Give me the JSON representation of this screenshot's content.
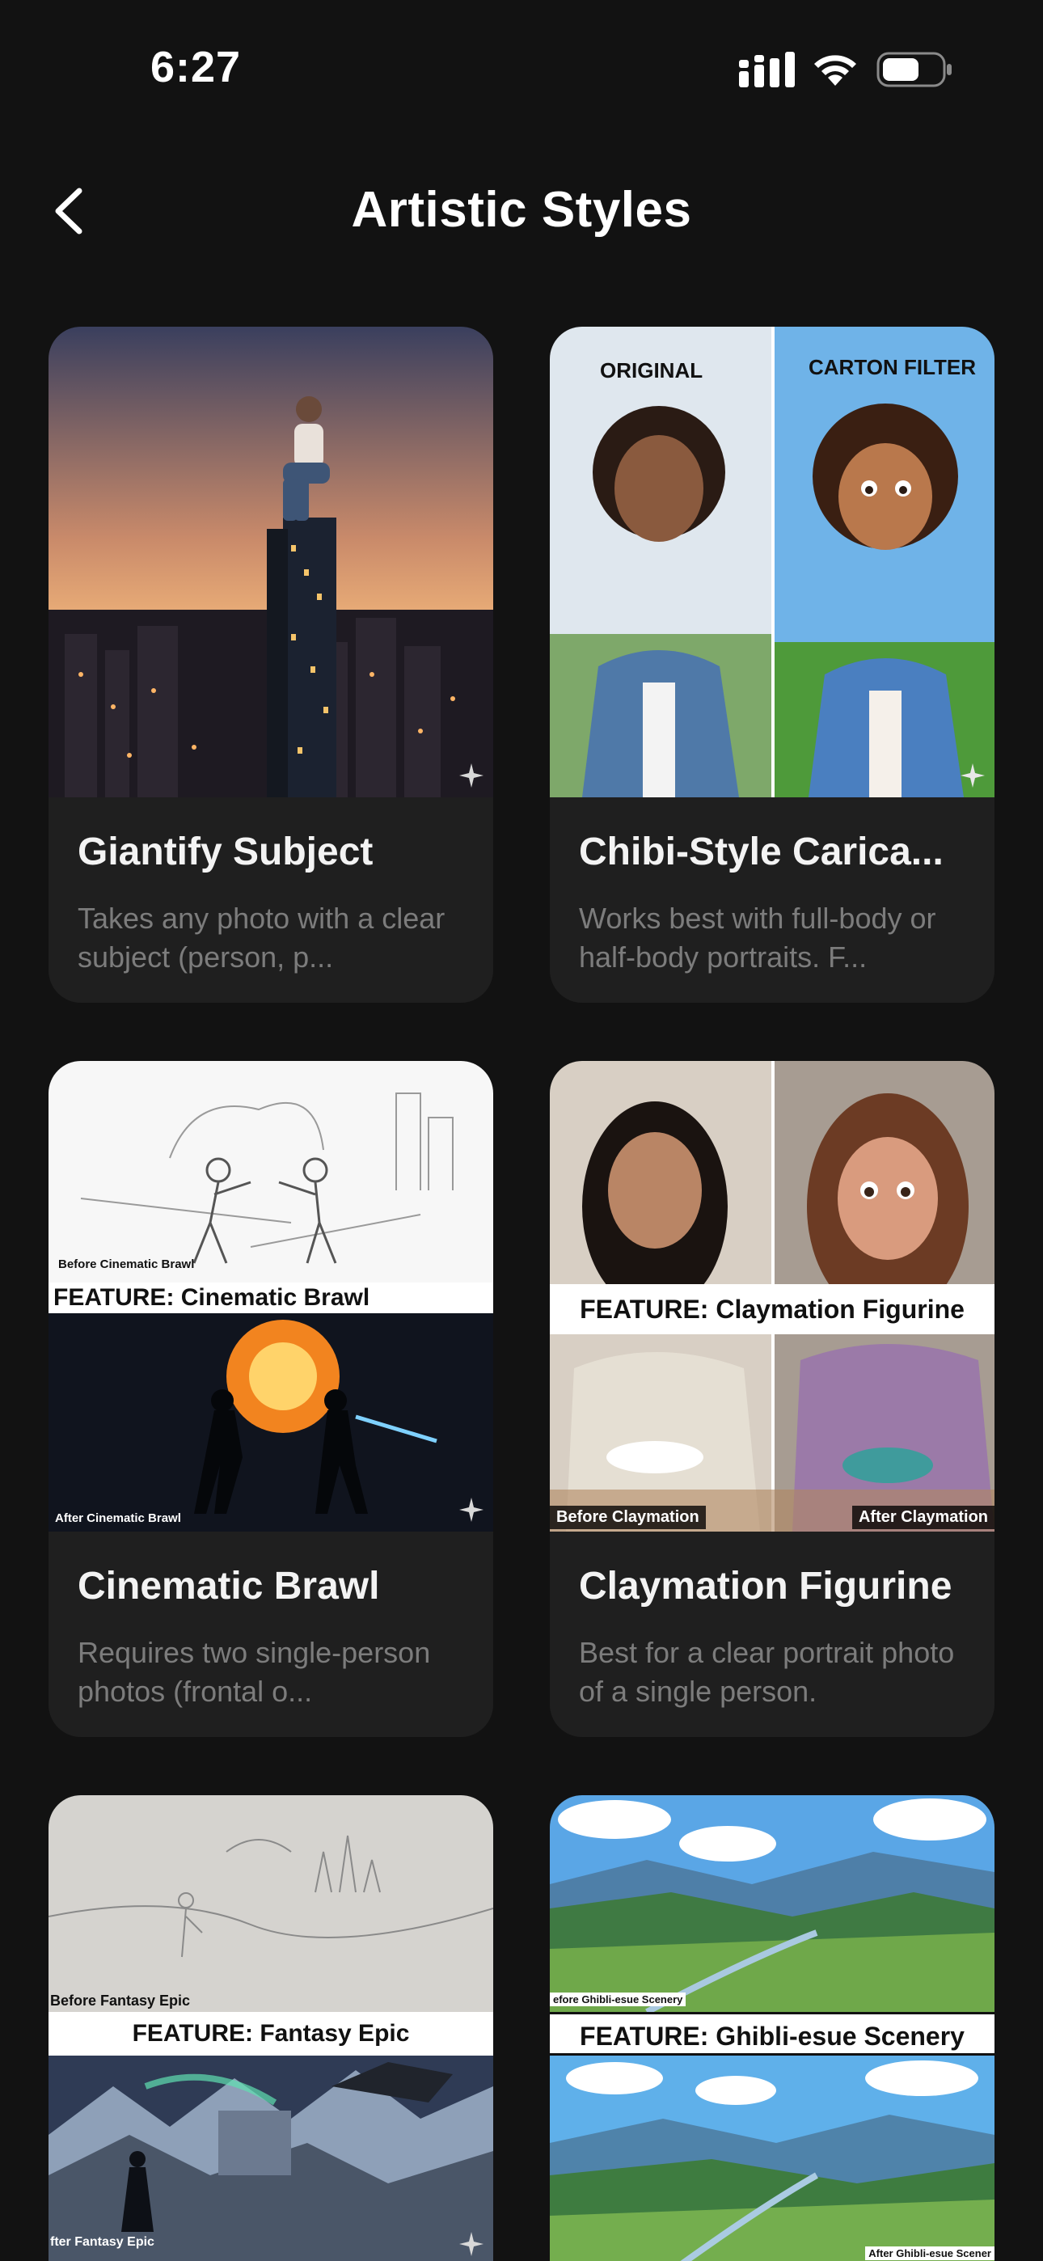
{
  "status_bar": {
    "time": "6:27"
  },
  "header": {
    "title": "Artistic Styles"
  },
  "cards": [
    {
      "title": "Giantify Subject",
      "description": "Takes any photo with a clear subject (person, p..."
    },
    {
      "title": "Chibi-Style Carica...",
      "description": "Works best with full-body or half-body portraits. F...",
      "image_labels": {
        "left": "ORIGINAL",
        "right": "CARTON FILTER"
      }
    },
    {
      "title": "Cinematic Brawl",
      "description": "Requires two single-person photos (frontal o...",
      "image_labels": {
        "before": "Before Cinematic Brawl",
        "feature": "FEATURE: Cinematic Brawl",
        "after": "After Cinematic Brawl"
      }
    },
    {
      "title": "Claymation Figurine",
      "description": "Best for a clear portrait photo of a single person.",
      "image_labels": {
        "feature": "FEATURE: Claymation Figurine",
        "before": "Before Claymation",
        "after": "After Claymation"
      }
    },
    {
      "title": "",
      "description": "",
      "image_labels": {
        "before": "Before Fantasy Epic",
        "feature": "FEATURE: Fantasy Epic",
        "after": "fter Fantasy Epic"
      }
    },
    {
      "title": "",
      "description": "",
      "image_labels": {
        "before": "efore Ghibli-esue Scenery",
        "feature": "FEATURE: Ghibli-esue Scenery",
        "after": "After Ghibli-esue Scener"
      }
    }
  ],
  "colors": {
    "background": "#121212",
    "card": "#1f1f1f",
    "title": "#f3f3f3",
    "description": "#7c7c7c"
  }
}
